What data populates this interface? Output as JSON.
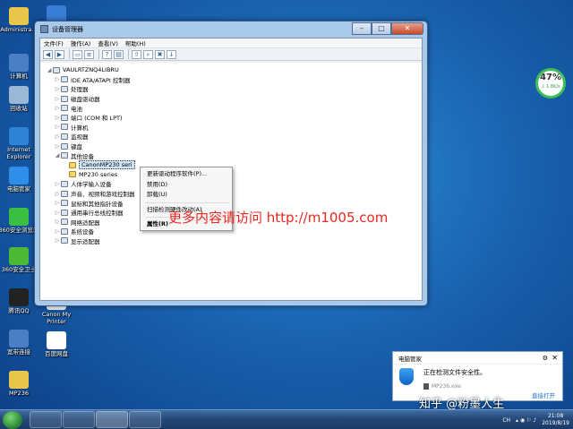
{
  "desktop": {
    "icons": [
      {
        "label": "Administra...",
        "color": "#e9c54a"
      },
      {
        "label": "计算机",
        "color": "#4a7fc6"
      },
      {
        "label": "回收站",
        "color": "#9bb7d6"
      },
      {
        "label": "Internet Explorer",
        "color": "#2f83d6"
      },
      {
        "label": "电脑管家",
        "color": "#2f8ee8"
      },
      {
        "label": "360安全浏览器",
        "color": "#3bbf42"
      },
      {
        "label": "360安全卫士",
        "color": "#4cba35"
      },
      {
        "label": "腾讯QQ",
        "color": "#222222"
      },
      {
        "label": "宽带连接",
        "color": "#4a7fc6"
      },
      {
        "label": "MP236",
        "color": "#e9c54a"
      }
    ],
    "col2_icons": [
      {
        "label": "",
        "color": "#3a7dd6"
      },
      {
        "label": "Canon My Printer",
        "color": "#eeeeee"
      },
      {
        "label": "百度网盘",
        "color": "#ffffff"
      }
    ]
  },
  "window": {
    "title": "设备管理器",
    "minimize_label": "–",
    "maximize_label": "□",
    "close_label": "✕",
    "menu": [
      "文件(F)",
      "操作(A)",
      "查看(V)",
      "帮助(H)"
    ],
    "tree": [
      {
        "label": "VAULRTZNQ4LIBRU",
        "level": 0,
        "arrow": "◢",
        "icon": "computer-icon"
      },
      {
        "label": "IDE ATA/ATAPI 控制器",
        "level": 1,
        "arrow": "▷",
        "icon": "ide-controller-icon"
      },
      {
        "label": "处理器",
        "level": 1,
        "arrow": "▷",
        "icon": "processor-icon"
      },
      {
        "label": "磁盘驱动器",
        "level": 1,
        "arrow": "▷",
        "icon": "disk-drive-icon"
      },
      {
        "label": "电池",
        "level": 1,
        "arrow": "▷",
        "icon": "battery-icon"
      },
      {
        "label": "端口 (COM 和 LPT)",
        "level": 1,
        "arrow": "▷",
        "icon": "port-icon"
      },
      {
        "label": "计算机",
        "level": 1,
        "arrow": "▷",
        "icon": "computer-icon"
      },
      {
        "label": "监视器",
        "level": 1,
        "arrow": "▷",
        "icon": "monitor-icon"
      },
      {
        "label": "键盘",
        "level": 1,
        "arrow": "▷",
        "icon": "keyboard-icon"
      },
      {
        "label": "其他设备",
        "level": 1,
        "arrow": "◢",
        "icon": "other-devices-icon"
      },
      {
        "label": "CanonMP230 seri",
        "level": 2,
        "arrow": "",
        "icon": "warning-device-icon",
        "selected": true
      },
      {
        "label": "MP230 series",
        "level": 2,
        "arrow": "",
        "icon": "warning-device-icon"
      },
      {
        "label": "人体学输入设备",
        "level": 1,
        "arrow": "▷",
        "icon": "hid-icon"
      },
      {
        "label": "声音、视频和游戏控制器",
        "level": 1,
        "arrow": "▷",
        "icon": "sound-icon"
      },
      {
        "label": "鼠标和其他指针设备",
        "level": 1,
        "arrow": "▷",
        "icon": "mouse-icon"
      },
      {
        "label": "通用串行总线控制器",
        "level": 1,
        "arrow": "▷",
        "icon": "usb-icon"
      },
      {
        "label": "网络适配器",
        "level": 1,
        "arrow": "▷",
        "icon": "network-icon"
      },
      {
        "label": "系统设备",
        "level": 1,
        "arrow": "▷",
        "icon": "system-devices-icon"
      },
      {
        "label": "显示适配器",
        "level": 1,
        "arrow": "▷",
        "icon": "display-adapter-icon"
      }
    ]
  },
  "context_menu": {
    "items": [
      "更新驱动程序软件(P)...",
      "禁用(D)",
      "卸载(U)",
      "扫描检测硬件改动(A)",
      "属性(R)"
    ]
  },
  "overlay_text": "更多内容请访问 http://m1005.com",
  "cpu_widget": {
    "percent": "47%",
    "speed": "↓ 1.8K/s",
    "accent": "#3fbf58"
  },
  "notification": {
    "app": "电脑管家",
    "message": "正在检测文件安全性。",
    "file": "MP236.exe",
    "action": "直接打开"
  },
  "watermark": "知乎 @粉墨人生",
  "taskbar": {
    "lang": "CH",
    "time": "21:08",
    "date": "2019/8/19"
  }
}
